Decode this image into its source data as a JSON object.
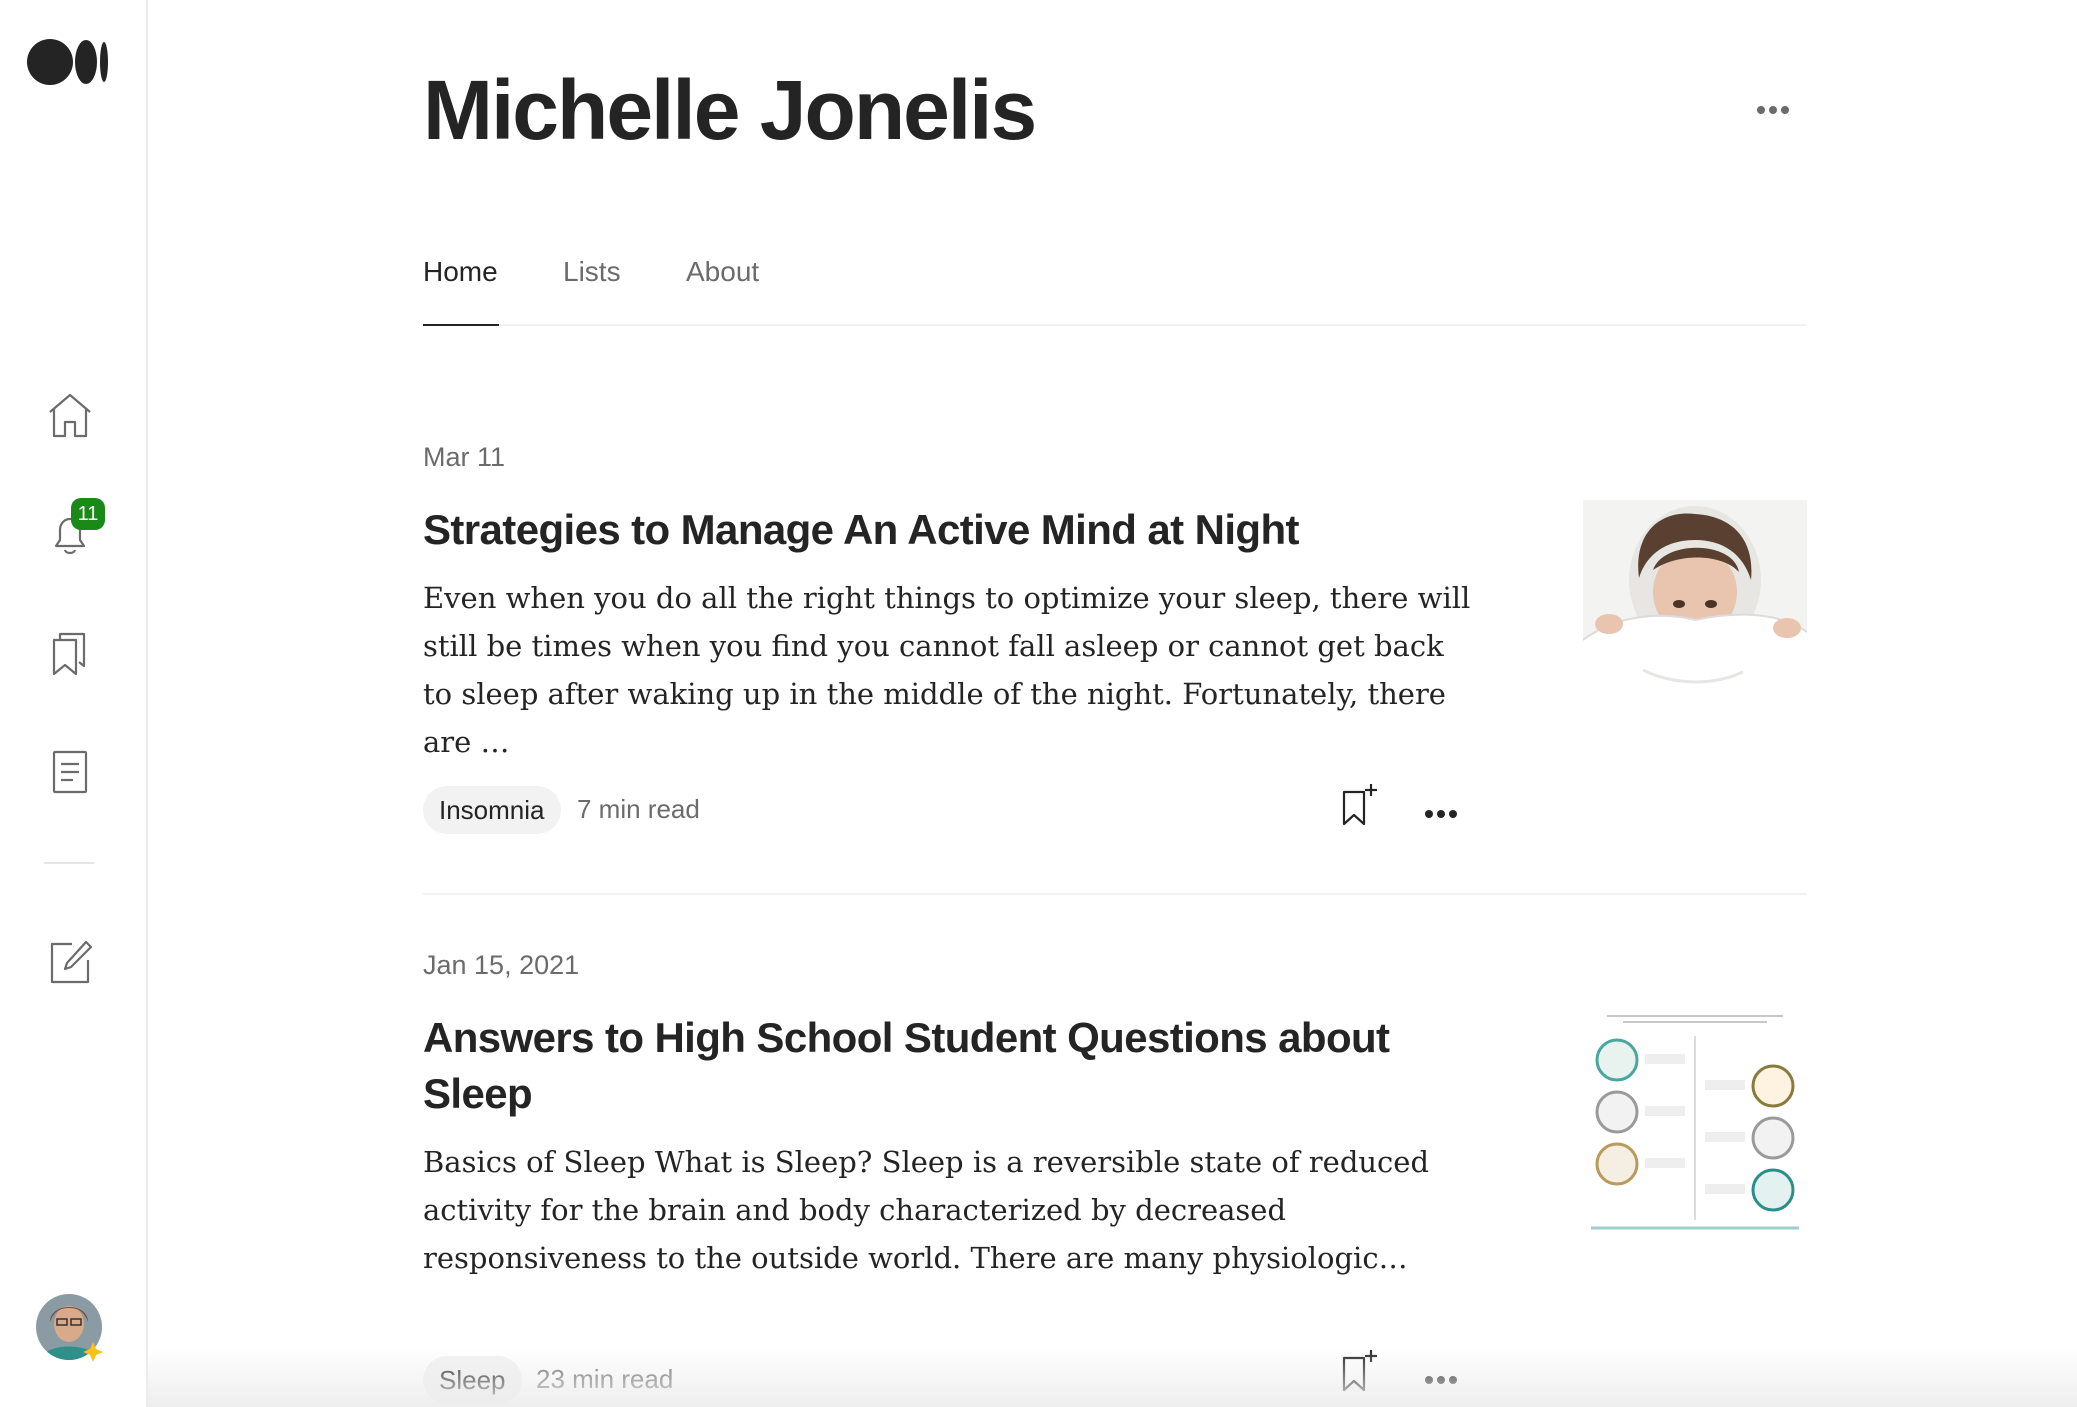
{
  "sidebar": {
    "logo": "medium-logo",
    "items": [
      {
        "icon": "home-icon"
      },
      {
        "icon": "bell-icon",
        "badge": "11"
      },
      {
        "icon": "bookmarks-icon"
      },
      {
        "icon": "stories-icon"
      },
      {
        "icon": "write-icon"
      }
    ],
    "avatar": "user-avatar"
  },
  "profile": {
    "name": "Michelle Jonelis"
  },
  "tabs": [
    {
      "label": "Home",
      "active": true
    },
    {
      "label": "Lists",
      "active": false
    },
    {
      "label": "About",
      "active": false
    }
  ],
  "articles": [
    {
      "date": "Mar 11",
      "title": "Strategies to Manage An Active Mind at Night",
      "excerpt": "Even when you do all the right things to optimize your sleep, there will still be times when you find you cannot fall asleep or cannot get back to sleep after waking up in the middle of the night. Fortunately, there are …",
      "tag": "Insomnia",
      "read_time": "7 min read"
    },
    {
      "date": "Jan 15, 2021",
      "title": "Answers to High School Student Questions about Sleep",
      "excerpt": "Basics of Sleep What is Sleep? Sleep is a reversible state of reduced activity for the brain and body characterized by decreased responsiveness to the outside world. There are many physiologic…",
      "tag": "Sleep",
      "read_time": "23 min read"
    }
  ],
  "colors": {
    "text": "#242424",
    "muted": "#6b6b6b",
    "badge": "#1a8917",
    "pill_bg": "#f2f2f2"
  }
}
